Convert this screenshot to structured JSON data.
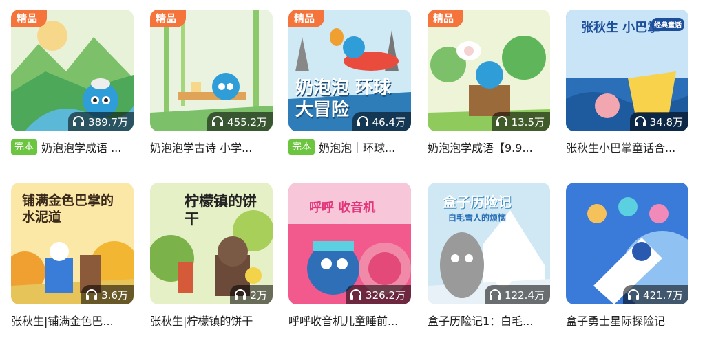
{
  "cards": [
    {
      "title": "奶泡泡学成语 ...",
      "plays": "389.7万",
      "premium": "精品",
      "complete": "完本"
    },
    {
      "title": "奶泡泡学古诗 小学...",
      "plays": "455.2万",
      "premium": "精品"
    },
    {
      "title": "奶泡泡｜环球...",
      "plays": "46.4万",
      "premium": "精品",
      "complete": "完本",
      "cover_text": "奶泡泡 环球大冒险"
    },
    {
      "title": "奶泡泡学成语【9.9...",
      "plays": "13.5万",
      "premium": "精品"
    },
    {
      "title": "张秋生小巴掌童话合...",
      "plays": "34.8万",
      "cover_text": "张秋生 小巴掌",
      "cover_tag": "经典童话"
    },
    {
      "title": "张秋生|铺满金色巴...",
      "plays": "3.6万",
      "cover_text": "铺满金色巴掌的水泥道"
    },
    {
      "title": "张秋生|柠檬镇的饼干",
      "plays": "2万",
      "cover_text": "柠檬镇的饼干"
    },
    {
      "title": "呼呼收音机儿童睡前...",
      "plays": "326.2万",
      "cover_text": "呼呼 收音机"
    },
    {
      "title": "盒子历险记1：白毛...",
      "plays": "122.4万",
      "cover_text": "盒子历险记",
      "cover_sub": "白毛雪人的烦恼"
    },
    {
      "title": "盒子勇士星际探险记",
      "plays": "421.7万"
    }
  ],
  "icons": {
    "plays": "headphones-icon"
  },
  "colors": {
    "premium": "#f4743b",
    "complete": "#6cc53f"
  }
}
